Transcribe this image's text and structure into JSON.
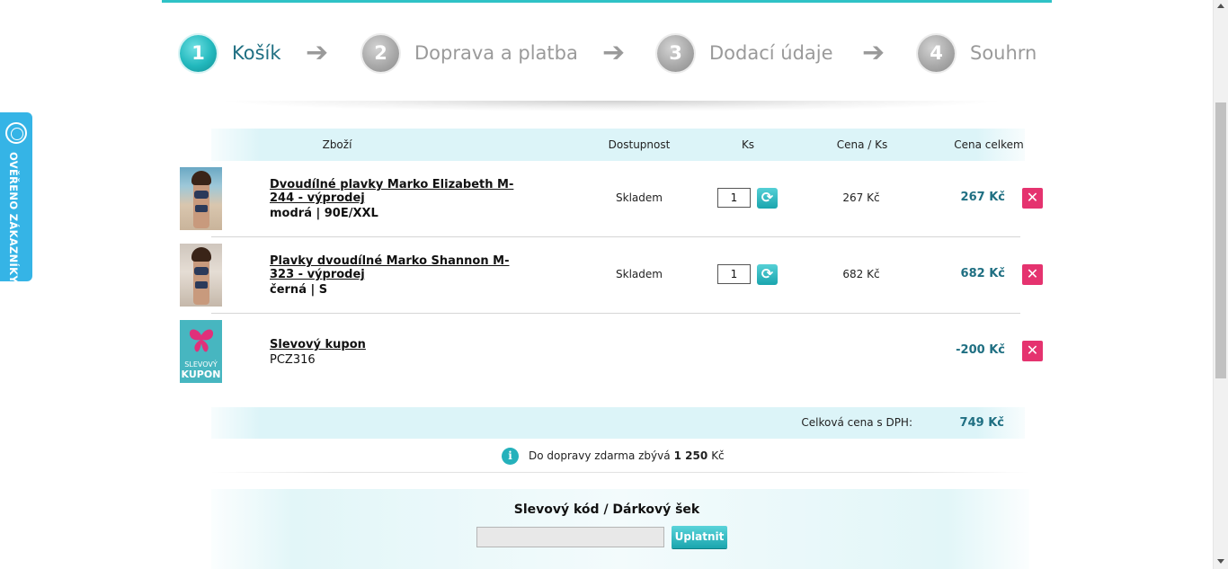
{
  "steps": [
    {
      "number": "1",
      "label": "Košík",
      "active": true
    },
    {
      "number": "2",
      "label": "Doprava a platba",
      "active": false
    },
    {
      "number": "3",
      "label": "Dodací údaje",
      "active": false
    },
    {
      "number": "4",
      "label": "Souhrn",
      "active": false
    }
  ],
  "side_badge": {
    "text": "OVĚŘENO ZÁKAZNÍKY",
    "icon": "verified-seal-icon",
    "color": "#35b4e6"
  },
  "table": {
    "headers": {
      "product": "Zboží",
      "availability": "Dostupnost",
      "quantity": "Ks",
      "unit_price": "Cena / Ks",
      "total": "Cena celkem"
    },
    "items": [
      {
        "name": "Dvoudílné plavky Marko Elizabeth M-244 - výprodej",
        "variant": "modrá  | 90E/XXL",
        "availability": "Skladem",
        "quantity": "1",
        "unit_price": "267 Kč",
        "total": "267 Kč"
      },
      {
        "name": "Plavky dvoudílné Marko Shannon M-323 - výprodej",
        "variant": "černá  | S",
        "availability": "Skladem",
        "quantity": "1",
        "unit_price": "682 Kč",
        "total": "682 Kč"
      }
    ],
    "coupon_item": {
      "name": "Slevový kupon",
      "code": "PCZ316",
      "thumb_line1": "SLEVOVÝ",
      "thumb_line2": "KUPON",
      "total": "-200 Kč"
    }
  },
  "summary": {
    "label": "Celková cena s DPH:",
    "value": "749 Kč"
  },
  "shipping": {
    "before": "Do dopravy zdarma zbývá",
    "amount": "1 250",
    "after": "Kč"
  },
  "coupon_form": {
    "title": "Slevový kód / Dárkový šek",
    "input_value": "",
    "button": "Uplatnit"
  },
  "colors": {
    "accent": "#2fc2c6",
    "price": "#1f6f82",
    "remove": "#e5336f"
  }
}
